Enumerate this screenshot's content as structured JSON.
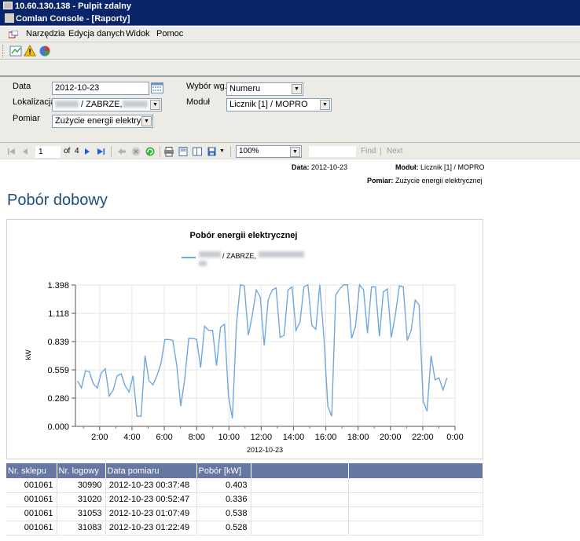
{
  "remote_title": "10.60.130.138 - Pulpit zdalny",
  "app_title": "Comlan Console - [Raporty]",
  "menu": [
    "Narzędzia",
    "Edycja danych",
    "Widok",
    "Pomoc"
  ],
  "params": {
    "date_label": "Data",
    "date_value": "2012-10-23",
    "location_label": "Lokalizacja",
    "location_value": " / ZABRZE,",
    "measure_label": "Pomiar",
    "measure_value": "Zużycie energii elektrycznej",
    "choice_label": "Wybór wg.",
    "choice_value": "Numeru",
    "module_label": "Moduł",
    "module_value": "Licznik [1] / MOPRO"
  },
  "nav": {
    "page": "1",
    "of_label": "of",
    "total_pages": "4",
    "zoom": "100%",
    "find": "Find",
    "next": "Next"
  },
  "report": {
    "date_label": "Data:",
    "date_value": "2012-10-23",
    "module_label": "Moduł:",
    "module_value": "Licznik [1] / MOPRO",
    "measure_label": "Pomiar:",
    "measure_value": "Zużycie energii elektrycznej",
    "title": "Pobór dobowy"
  },
  "chart_data": {
    "type": "line",
    "title": "Pobór energii elektrycznej",
    "legend": " / ZABRZE,",
    "xlabel": "2012-10-23",
    "ylabel": "kW",
    "x_ticks": [
      "2:00",
      "4:00",
      "6:00",
      "8:00",
      "10:00",
      "12:00",
      "14:00",
      "16:00",
      "18:00",
      "20:00",
      "22:00",
      "0:00"
    ],
    "y_ticks": [
      "0.000",
      "0.280",
      "0.559",
      "0.839",
      "1.118",
      "1.398"
    ],
    "ylim": [
      0,
      1.398
    ],
    "xlim_hours": [
      0.5,
      24
    ],
    "color": "#6fa8dc",
    "values": [
      0.45,
      0.38,
      0.55,
      0.54,
      0.42,
      0.38,
      0.53,
      0.57,
      0.3,
      0.36,
      0.5,
      0.52,
      0.4,
      0.34,
      0.5,
      0.1,
      0.1,
      0.7,
      0.45,
      0.41,
      0.5,
      0.62,
      0.86,
      0.86,
      0.85,
      0.6,
      0.2,
      0.47,
      0.87,
      0.87,
      0.86,
      0.58,
      0.99,
      0.95,
      0.95,
      0.6,
      0.98,
      1.01,
      0.3,
      0.08,
      1.0,
      1.4,
      1.39,
      0.9,
      1.1,
      1.35,
      1.28,
      0.8,
      1.25,
      1.35,
      1.37,
      0.88,
      0.9,
      1.35,
      1.38,
      0.95,
      1.03,
      1.38,
      1.4,
      1.0,
      0.96,
      1.4,
      0.9,
      0.2,
      0.1,
      1.3,
      1.36,
      1.4,
      1.4,
      0.87,
      0.99,
      1.4,
      1.35,
      0.92,
      1.38,
      1.38,
      0.89,
      1.33,
      1.36,
      0.88,
      1.1,
      1.39,
      1.38,
      0.85,
      0.95,
      1.25,
      1.2,
      0.25,
      0.15,
      0.7,
      0.46,
      0.48,
      0.36,
      0.48
    ]
  },
  "table": {
    "headers": [
      "Nr. sklepu",
      "Nr. logowy",
      "Data pomiaru",
      "Pobór [kW]"
    ],
    "rows": [
      [
        "001061",
        "30990",
        "2012-10-23 00:37:48",
        "0.403"
      ],
      [
        "001061",
        "31020",
        "2012-10-23 00:52:47",
        "0.336"
      ],
      [
        "001061",
        "31053",
        "2012-10-23 01:07:49",
        "0.538"
      ],
      [
        "001061",
        "31083",
        "2012-10-23 01:22:49",
        "0.528"
      ]
    ]
  }
}
